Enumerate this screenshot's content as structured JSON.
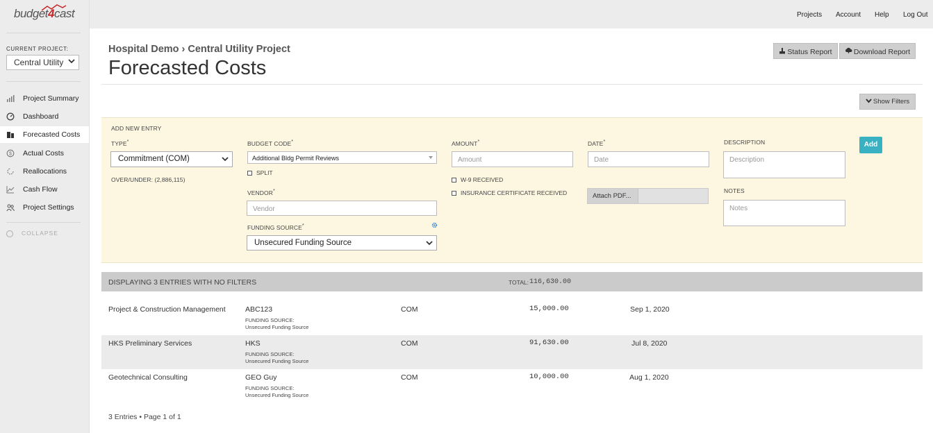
{
  "app": {
    "logo_prefix": "budget",
    "logo_four": "4",
    "logo_suffix": "cast"
  },
  "topnav": [
    "Projects",
    "Account",
    "Help",
    "Log Out"
  ],
  "sidebar": {
    "current_project_label": "CURRENT PROJECT:",
    "current_project_value": "Central Utility",
    "items": [
      {
        "label": "Project Summary",
        "icon": "bar-chart-icon"
      },
      {
        "label": "Dashboard",
        "icon": "gauge-icon"
      },
      {
        "label": "Forecasted Costs",
        "icon": "clipboard-icon",
        "active": true
      },
      {
        "label": "Actual Costs",
        "icon": "dollar-circle-icon"
      },
      {
        "label": "Reallocations",
        "icon": "refresh-icon"
      },
      {
        "label": "Cash Flow",
        "icon": "line-chart-icon"
      },
      {
        "label": "Project Settings",
        "icon": "users-icon"
      }
    ],
    "collapse_label": "COLLAPSE"
  },
  "header": {
    "breadcrumb": "Hospital Demo › Central Utility Project",
    "title": "Forecasted Costs",
    "status_report": "Status Report",
    "download_report": "Download Report",
    "show_filters": "Show Filters"
  },
  "entry": {
    "section_label": "ADD NEW ENTRY",
    "type_label": "TYPE",
    "type_value": "Commitment (COM)",
    "over_under": "OVER/UNDER: (2,886,115)",
    "budget_code_label": "BUDGET CODE",
    "budget_code_value": "Additional Bldg Permit Reviews",
    "split_label": "SPLIT",
    "vendor_label": "VENDOR",
    "vendor_placeholder": "Vendor",
    "funding_source_label": "FUNDING SOURCE",
    "funding_source_value": "Unsecured Funding Source",
    "amount_label": "AMOUNT",
    "amount_placeholder": "Amount",
    "w9_label": "W-9 RECEIVED",
    "insurance_label": "INSURANCE CERTIFICATE RECEIVED",
    "date_label": "DATE",
    "date_placeholder": "Date",
    "attach_label": "Attach PDF...",
    "description_label": "DESCRIPTION",
    "description_placeholder": "Description",
    "notes_label": "NOTES",
    "notes_placeholder": "Notes",
    "add_label": "Add",
    "required_mark": "*"
  },
  "list": {
    "header": "DISPLAYING 3 ENTRIES WITH NO FILTERS",
    "total_label": "TOTAL:",
    "total_value": "116,630.00",
    "funding_source_label": "FUNDING SOURCE:",
    "rows": [
      {
        "name": "Project & Construction Management",
        "code": "ABC123",
        "funding": "Unsecured Funding Source",
        "type": "COM",
        "amount": "15,000.00",
        "date": "Sep 1, 2020"
      },
      {
        "name": "HKS Preliminary Services",
        "code": "HKS",
        "funding": "Unsecured Funding Source",
        "type": "COM",
        "amount": "91,630.00",
        "date": "Jul 8, 2020"
      },
      {
        "name": "Geotechnical Consulting",
        "code": "GEO Guy",
        "funding": "Unsecured Funding Source",
        "type": "COM",
        "amount": "10,000.00",
        "date": "Aug 1, 2020"
      }
    ],
    "footer": "3 Entries • Page 1 of 1"
  }
}
